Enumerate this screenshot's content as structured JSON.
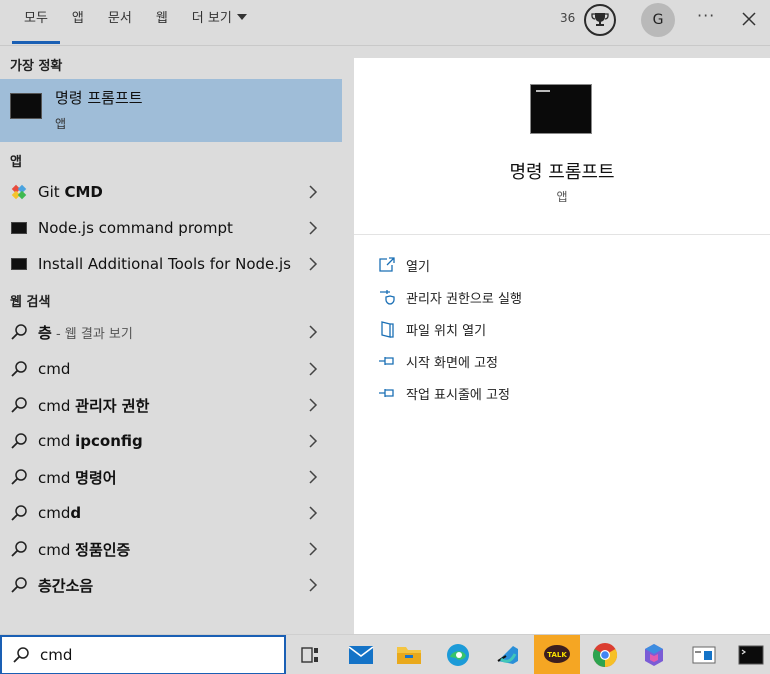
{
  "tabs": [
    {
      "label": "모두",
      "active": true
    },
    {
      "label": "앱"
    },
    {
      "label": "문서"
    },
    {
      "label": "웹"
    },
    {
      "label": "더 보기"
    }
  ],
  "header": {
    "count": "36",
    "avatar": "G",
    "more": "···"
  },
  "sections": {
    "best": "가장 정확",
    "apps": "앱",
    "web": "웹 검색"
  },
  "best_match": {
    "name": "명령 프롬프트",
    "kind": "앱"
  },
  "apps": [
    {
      "pre": "Git ",
      "bold": "CMD",
      "icon": "git-icon"
    },
    {
      "pre": "Node.js command prompt",
      "bold": "",
      "icon": "terminal-icon"
    },
    {
      "pre": "Install Additional Tools for Node.js",
      "bold": "",
      "icon": "terminal-icon"
    }
  ],
  "web": [
    {
      "pre": "",
      "bold": "층",
      "sub": " - 웹 결과 보기"
    },
    {
      "pre": "cmd",
      "bold": "",
      "sub": ""
    },
    {
      "pre": "cmd ",
      "bold": "관리자 권한",
      "sub": ""
    },
    {
      "pre": "cmd ",
      "bold": "ipconfig",
      "sub": ""
    },
    {
      "pre": "cmd ",
      "bold": "명령어",
      "sub": ""
    },
    {
      "pre": "cmd",
      "bold": "d",
      "sub": ""
    },
    {
      "pre": "cmd ",
      "bold": "정품인증",
      "sub": ""
    },
    {
      "pre": "",
      "bold": "층간소음",
      "sub": ""
    }
  ],
  "detail": {
    "title": "명령 프롬프트",
    "kind": "앱",
    "actions": [
      {
        "label": "열기",
        "icon": "open-icon"
      },
      {
        "label": "관리자 권한으로 실행",
        "icon": "shield-icon"
      },
      {
        "label": "파일 위치 열기",
        "icon": "file-location-icon"
      },
      {
        "label": "시작 화면에 고정",
        "icon": "pin-icon"
      },
      {
        "label": "작업 표시줄에 고정",
        "icon": "pin-icon"
      }
    ]
  },
  "search": {
    "value": "cmd"
  },
  "taskbar": {
    "talk_label": "TALK",
    "apps": [
      "task-view",
      "mail",
      "file-explorer",
      "edge",
      "visual-studio-code",
      "kakaotalk",
      "chrome",
      "microsoft-365",
      "taskbar-app",
      "command-prompt"
    ]
  }
}
